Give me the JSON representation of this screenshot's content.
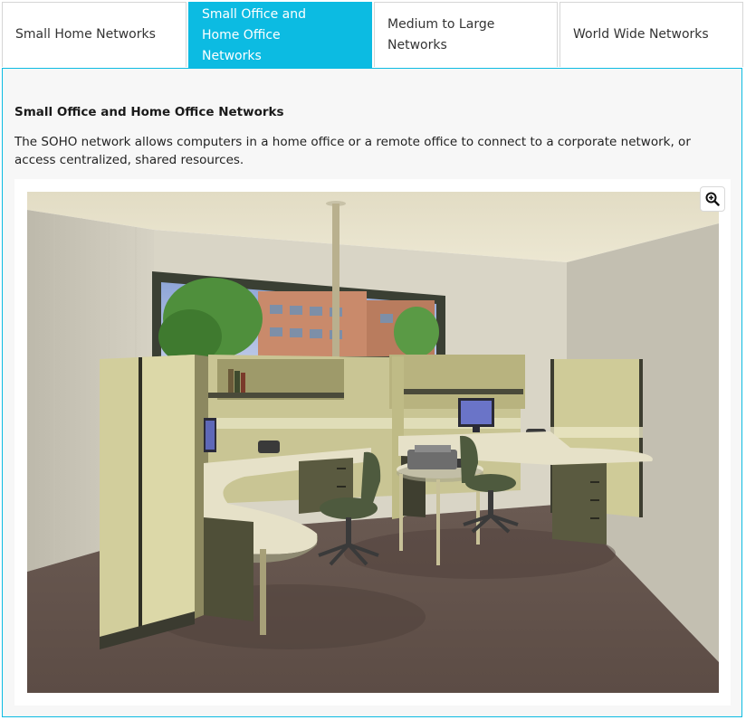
{
  "tabs": [
    {
      "label": "Small Home Networks",
      "active": false
    },
    {
      "label": "Small Office and Home Office Networks",
      "active": true
    },
    {
      "label": "Medium to Large Networks",
      "active": false
    },
    {
      "label": "World Wide Networks",
      "active": false
    }
  ],
  "panel": {
    "title": "Small Office and Home Office Networks",
    "description": "The SOHO network allows computers in a home office or a remote office to connect to a corporate network, or access centralized, shared resources."
  },
  "figure": {
    "zoom_icon": "zoom-in-icon"
  },
  "colors": {
    "accent": "#0cbbe2",
    "panel_bg": "#f7f7f7",
    "border": "#d6d6d6"
  }
}
